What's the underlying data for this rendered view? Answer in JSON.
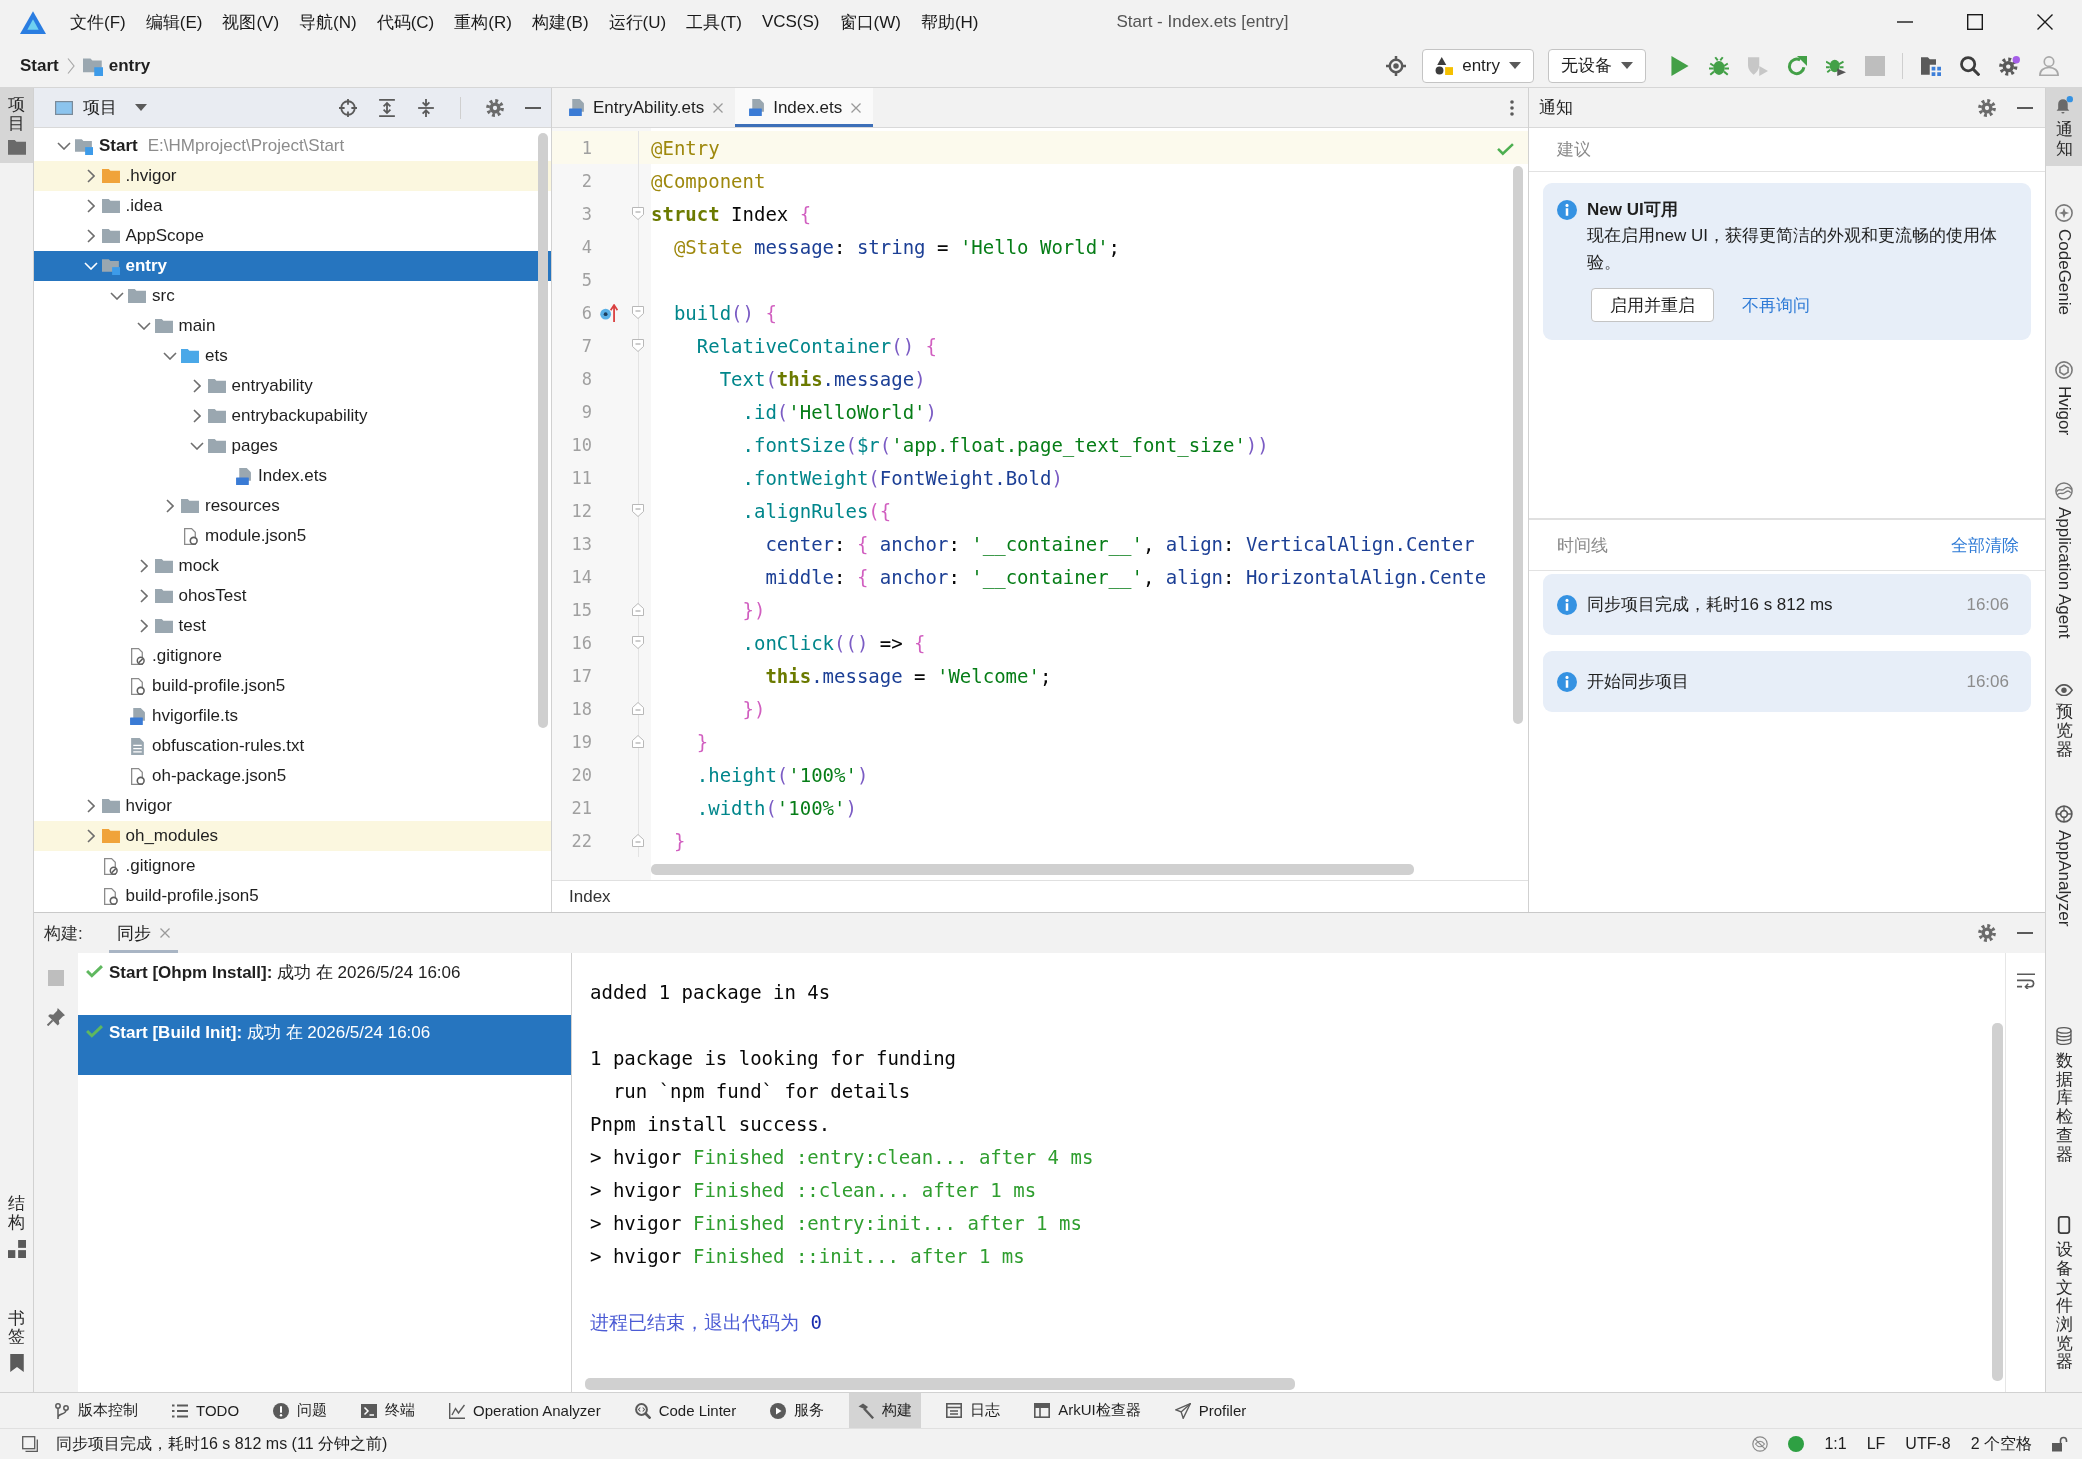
{
  "window": {
    "title": "Start - Index.ets [entry]",
    "menu": [
      "文件(F)",
      "编辑(E)",
      "视图(V)",
      "导航(N)",
      "代码(C)",
      "重构(R)",
      "构建(B)",
      "运行(U)",
      "工具(T)",
      "VCS(S)",
      "窗口(W)",
      "帮助(H)"
    ]
  },
  "nav_bar": {
    "breadcrumbs": [
      "Start",
      "entry"
    ],
    "run_config": "entry",
    "device": "无设备",
    "actions": [
      {
        "disabled": false
      },
      {
        "disabled": false
      },
      {
        "disabled": true
      },
      {
        "disabled": false
      },
      {
        "disabled": false
      },
      {
        "disabled": true
      }
    ]
  },
  "left_stripe": {
    "top": [
      {
        "label": "项目",
        "selected": true
      }
    ],
    "bottom": [
      {
        "label": "结构",
        "selected": false
      },
      {
        "label": "书签",
        "selected": false
      }
    ]
  },
  "project_panel": {
    "title": "项目",
    "tree": [
      {
        "name": "Start",
        "path": "E:\\HMproject\\Project\\Start",
        "kind": "module",
        "expanded": true,
        "selected": false,
        "children": [
          {
            "name": ".hvigor",
            "kind": "excluded",
            "expanded": false,
            "selected": false
          },
          {
            "name": ".idea",
            "kind": "folder",
            "expanded": false,
            "selected": false
          },
          {
            "name": "AppScope",
            "kind": "folder",
            "expanded": false,
            "selected": false
          },
          {
            "name": "entry",
            "kind": "module",
            "expanded": true,
            "selected": true,
            "children": [
              {
                "name": "src",
                "kind": "folder",
                "expanded": true,
                "selected": false,
                "children": [
                  {
                    "name": "main",
                    "kind": "folder",
                    "expanded": true,
                    "selected": false,
                    "children": [
                      {
                        "name": "ets",
                        "kind": "source",
                        "expanded": true,
                        "selected": false,
                        "children": [
                          {
                            "name": "entryability",
                            "kind": "folder",
                            "expanded": false,
                            "selected": false
                          },
                          {
                            "name": "entrybackupability",
                            "kind": "folder",
                            "expanded": false,
                            "selected": false
                          },
                          {
                            "name": "pages",
                            "kind": "folder",
                            "expanded": true,
                            "selected": false,
                            "children": [
                              {
                                "name": "Index.ets",
                                "kind": "script",
                                "selected": false
                              }
                            ]
                          }
                        ]
                      },
                      {
                        "name": "resources",
                        "kind": "folder",
                        "expanded": false,
                        "selected": false
                      },
                      {
                        "name": "module.json5",
                        "kind": "config",
                        "selected": false
                      }
                    ]
                  },
                  {
                    "name": "mock",
                    "kind": "folder",
                    "expanded": false,
                    "selected": false
                  },
                  {
                    "name": "ohosTest",
                    "kind": "folder",
                    "expanded": false,
                    "selected": false
                  },
                  {
                    "name": "test",
                    "kind": "folder",
                    "expanded": false,
                    "selected": false
                  }
                ]
              },
              {
                "name": ".gitignore",
                "kind": "ignore",
                "selected": false
              },
              {
                "name": "build-profile.json5",
                "kind": "config",
                "selected": false
              },
              {
                "name": "hvigorfile.ts",
                "kind": "script",
                "selected": false
              },
              {
                "name": "obfuscation-rules.txt",
                "kind": "text",
                "selected": false
              },
              {
                "name": "oh-package.json5",
                "kind": "config",
                "selected": false
              }
            ]
          },
          {
            "name": "hvigor",
            "kind": "folder",
            "expanded": false,
            "selected": false
          },
          {
            "name": "oh_modules",
            "kind": "excluded",
            "expanded": false,
            "selected": false
          },
          {
            "name": ".gitignore",
            "kind": "ignore",
            "selected": false
          },
          {
            "name": "build-profile.json5",
            "kind": "config",
            "selected": false
          }
        ]
      }
    ]
  },
  "editor": {
    "tabs": [
      {
        "label": "EntryAbility.ets",
        "selected": false
      },
      {
        "label": "Index.ets",
        "selected": true
      }
    ],
    "lines": [
      {
        "number": "1",
        "current": true,
        "tokens": [
          {
            "kind": "decorator",
            "text": "@Entry"
          }
        ]
      },
      {
        "number": "2",
        "current": false,
        "tokens": [
          {
            "kind": "decorator",
            "text": "@Component"
          }
        ]
      },
      {
        "number": "3",
        "current": false,
        "fold_open": true,
        "tokens": [
          {
            "kind": "keyword",
            "text": "struct"
          },
          {
            "kind": "plain",
            "text": " Index "
          },
          {
            "kind": "brace",
            "text": "{"
          }
        ]
      },
      {
        "number": "4",
        "current": false,
        "tokens": [
          {
            "kind": "decorator",
            "text": "  @State"
          },
          {
            "kind": "field",
            "text": " message"
          },
          {
            "kind": "plain",
            "text": ": "
          },
          {
            "kind": "field",
            "text": "string"
          },
          {
            "kind": "plain",
            "text": " = "
          },
          {
            "kind": "string",
            "text": "'Hello World'"
          },
          {
            "kind": "plain",
            "text": ";"
          }
        ]
      },
      {
        "number": "5",
        "current": false
      },
      {
        "number": "6",
        "current": false,
        "fold_open": true,
        "gutter_mark": true,
        "tokens": [
          {
            "kind": "func",
            "text": "  build"
          },
          {
            "kind": "paren",
            "text": "()"
          },
          {
            "kind": "brace",
            "text": " {"
          }
        ]
      },
      {
        "number": "7",
        "current": false,
        "fold_open": true,
        "tokens": [
          {
            "kind": "func",
            "text": "    RelativeContainer"
          },
          {
            "kind": "paren",
            "text": "()"
          },
          {
            "kind": "brace",
            "text": " {"
          }
        ]
      },
      {
        "number": "8",
        "current": false,
        "tokens": [
          {
            "kind": "func",
            "text": "      Text"
          },
          {
            "kind": "paren",
            "text": "("
          },
          {
            "kind": "keyword",
            "text": "this"
          },
          {
            "kind": "field",
            "text": ".message"
          },
          {
            "kind": "paren",
            "text": ")"
          }
        ]
      },
      {
        "number": "9",
        "current": false,
        "tokens": [
          {
            "kind": "func",
            "text": "        .id"
          },
          {
            "kind": "paren",
            "text": "("
          },
          {
            "kind": "string",
            "text": "'HelloWorld'"
          },
          {
            "kind": "paren",
            "text": ")"
          }
        ]
      },
      {
        "number": "10",
        "current": false,
        "tokens": [
          {
            "kind": "func",
            "text": "        .fontSize"
          },
          {
            "kind": "paren",
            "text": "("
          },
          {
            "kind": "func",
            "text": "$r"
          },
          {
            "kind": "paren",
            "text": "("
          },
          {
            "kind": "string",
            "text": "'app.float.page_text_font_size'"
          },
          {
            "kind": "paren",
            "text": "))"
          }
        ]
      },
      {
        "number": "11",
        "current": false,
        "tokens": [
          {
            "kind": "func",
            "text": "        .fontWeight"
          },
          {
            "kind": "paren",
            "text": "("
          },
          {
            "kind": "field",
            "text": "FontWeight.Bold"
          },
          {
            "kind": "paren",
            "text": ")"
          }
        ]
      },
      {
        "number": "12",
        "current": false,
        "fold_open": true,
        "tokens": [
          {
            "kind": "func",
            "text": "        .alignRules"
          },
          {
            "kind": "brace",
            "text": "({"
          }
        ]
      },
      {
        "number": "13",
        "current": false,
        "tokens": [
          {
            "kind": "field",
            "text": "          center"
          },
          {
            "kind": "plain",
            "text": ": "
          },
          {
            "kind": "brace",
            "text": "{"
          },
          {
            "kind": "field",
            "text": " anchor"
          },
          {
            "kind": "plain",
            "text": ": "
          },
          {
            "kind": "string",
            "text": "'__container__'"
          },
          {
            "kind": "plain",
            "text": ", "
          },
          {
            "kind": "field",
            "text": "align"
          },
          {
            "kind": "plain",
            "text": ": "
          },
          {
            "kind": "field",
            "text": "VerticalAlign.Center"
          }
        ]
      },
      {
        "number": "14",
        "current": false,
        "tokens": [
          {
            "kind": "field",
            "text": "          middle"
          },
          {
            "kind": "plain",
            "text": ": "
          },
          {
            "kind": "brace",
            "text": "{"
          },
          {
            "kind": "field",
            "text": " anchor"
          },
          {
            "kind": "plain",
            "text": ": "
          },
          {
            "kind": "string",
            "text": "'__container__'"
          },
          {
            "kind": "plain",
            "text": ", "
          },
          {
            "kind": "field",
            "text": "align"
          },
          {
            "kind": "plain",
            "text": ": "
          },
          {
            "kind": "field",
            "text": "HorizontalAlign.Cente"
          }
        ]
      },
      {
        "number": "15",
        "current": false,
        "fold_close": true,
        "tokens": [
          {
            "kind": "brace",
            "text": "        })"
          }
        ]
      },
      {
        "number": "16",
        "current": false,
        "fold_open": true,
        "tokens": [
          {
            "kind": "func",
            "text": "        .onClick"
          },
          {
            "kind": "paren",
            "text": "(()"
          },
          {
            "kind": "plain",
            "text": " => "
          },
          {
            "kind": "brace",
            "text": "{"
          }
        ]
      },
      {
        "number": "17",
        "current": false,
        "tokens": [
          {
            "kind": "keyword",
            "text": "          this"
          },
          {
            "kind": "field",
            "text": ".message"
          },
          {
            "kind": "plain",
            "text": " = "
          },
          {
            "kind": "string",
            "text": "'Welcome'"
          },
          {
            "kind": "plain",
            "text": ";"
          }
        ]
      },
      {
        "number": "18",
        "current": false,
        "fold_close": true,
        "tokens": [
          {
            "kind": "brace",
            "text": "        })"
          }
        ]
      },
      {
        "number": "19",
        "current": false,
        "fold_close": true,
        "tokens": [
          {
            "kind": "brace",
            "text": "    }"
          }
        ]
      },
      {
        "number": "20",
        "current": false,
        "tokens": [
          {
            "kind": "func",
            "text": "    .height"
          },
          {
            "kind": "paren",
            "text": "("
          },
          {
            "kind": "string",
            "text": "'100%'"
          },
          {
            "kind": "paren",
            "text": ")"
          }
        ]
      },
      {
        "number": "21",
        "current": false,
        "tokens": [
          {
            "kind": "func",
            "text": "    .width"
          },
          {
            "kind": "paren",
            "text": "("
          },
          {
            "kind": "string",
            "text": "'100%'"
          },
          {
            "kind": "paren",
            "text": ")"
          }
        ]
      },
      {
        "number": "22",
        "current": false,
        "fold_close": true,
        "tokens": [
          {
            "kind": "brace",
            "text": "  }"
          }
        ]
      }
    ],
    "breadcrumb": "Index"
  },
  "notifications": {
    "title": "通知",
    "suggestions_label": "建议",
    "suggestion": {
      "title": "New UI可用",
      "body": "现在启用new UI，获得更简洁的外观和更流畅的使用体验。",
      "button": "启用并重启",
      "link": "不再询问"
    },
    "timeline_label": "时间线",
    "clear_all": "全部清除",
    "timeline": [
      {
        "text": "同步项目完成，耗时16 s 812 ms",
        "time": "16:06"
      },
      {
        "text": "开始同步项目",
        "time": "16:06"
      }
    ]
  },
  "right_stripe": {
    "top": [
      {
        "label": "通知",
        "selected": true
      },
      {
        "label": "CodeGenie",
        "selected": false
      },
      {
        "label": "Hvigor",
        "selected": false
      },
      {
        "label": "Application Agent",
        "selected": false
      },
      {
        "label": "预览器",
        "selected": false
      },
      {
        "label": "AppAnalyzer",
        "selected": false
      }
    ],
    "bottom": [
      {
        "label": "数据库检查器",
        "selected": false
      },
      {
        "label": "设备文件浏览器",
        "selected": false
      }
    ]
  },
  "build_panel": {
    "label": "构建:",
    "tabs": [
      {
        "label": "同步",
        "selected": true
      }
    ],
    "stop_disabled": true,
    "tasks": [
      {
        "text": "**Start [Ohpm Install]:** 成功 在 2026/5/24 16:06",
        "selected": false
      },
      {
        "text": "**Start [Build Init]:** 成功 在 2026/5/24 16:06",
        "selected": true
      }
    ],
    "console": [
      {
        "lines": [
          [
            {
              "kind": "plain",
              "text": "added 1 package in 4s"
            }
          ]
        ]
      },
      {
        "lines": [
          [
            {
              "kind": "plain",
              "text": "1 package is looking for funding"
            }
          ],
          [
            {
              "kind": "plain",
              "text": "  run `npm fund` for details"
            }
          ],
          [
            {
              "kind": "plain",
              "text": "Pnpm install success."
            }
          ],
          [
            {
              "kind": "plain",
              "text": "> hvigor "
            },
            {
              "kind": "success",
              "text": "Finished :entry:clean... after 4 ms"
            }
          ],
          [
            {
              "kind": "plain",
              "text": "> hvigor "
            },
            {
              "kind": "success",
              "text": "Finished ::clean... after 1 ms"
            }
          ],
          [
            {
              "kind": "plain",
              "text": "> hvigor "
            },
            {
              "kind": "success",
              "text": "Finished :entry:init... after 1 ms"
            }
          ],
          [
            {
              "kind": "plain",
              "text": "> hvigor "
            },
            {
              "kind": "success",
              "text": "Finished ::init... after 1 ms"
            }
          ]
        ]
      },
      {
        "lines": [
          [
            {
              "kind": "system",
              "text": "进程已结束，退出代码为 "
            },
            {
              "kind": "code",
              "text": "0"
            }
          ]
        ]
      }
    ]
  },
  "tool_windows": [
    {
      "label": "版本控制",
      "selected": false
    },
    {
      "label": "TODO",
      "selected": false
    },
    {
      "label": "问题",
      "selected": false
    },
    {
      "label": "终端",
      "selected": false
    },
    {
      "label": "Operation Analyzer",
      "selected": false
    },
    {
      "label": "Code Linter",
      "selected": false
    },
    {
      "label": "服务",
      "selected": false
    },
    {
      "label": "构建",
      "selected": true
    },
    {
      "label": "日志",
      "selected": false
    },
    {
      "label": "ArkUI检查器",
      "selected": false
    },
    {
      "label": "Profiler",
      "selected": false
    }
  ],
  "status_bar": {
    "message": "同步项目完成，耗时16 s 812 ms (11 分钟之前)",
    "position": "1:1",
    "line_separator": "LF",
    "encoding": "UTF-8",
    "indent": "2 个空格"
  }
}
